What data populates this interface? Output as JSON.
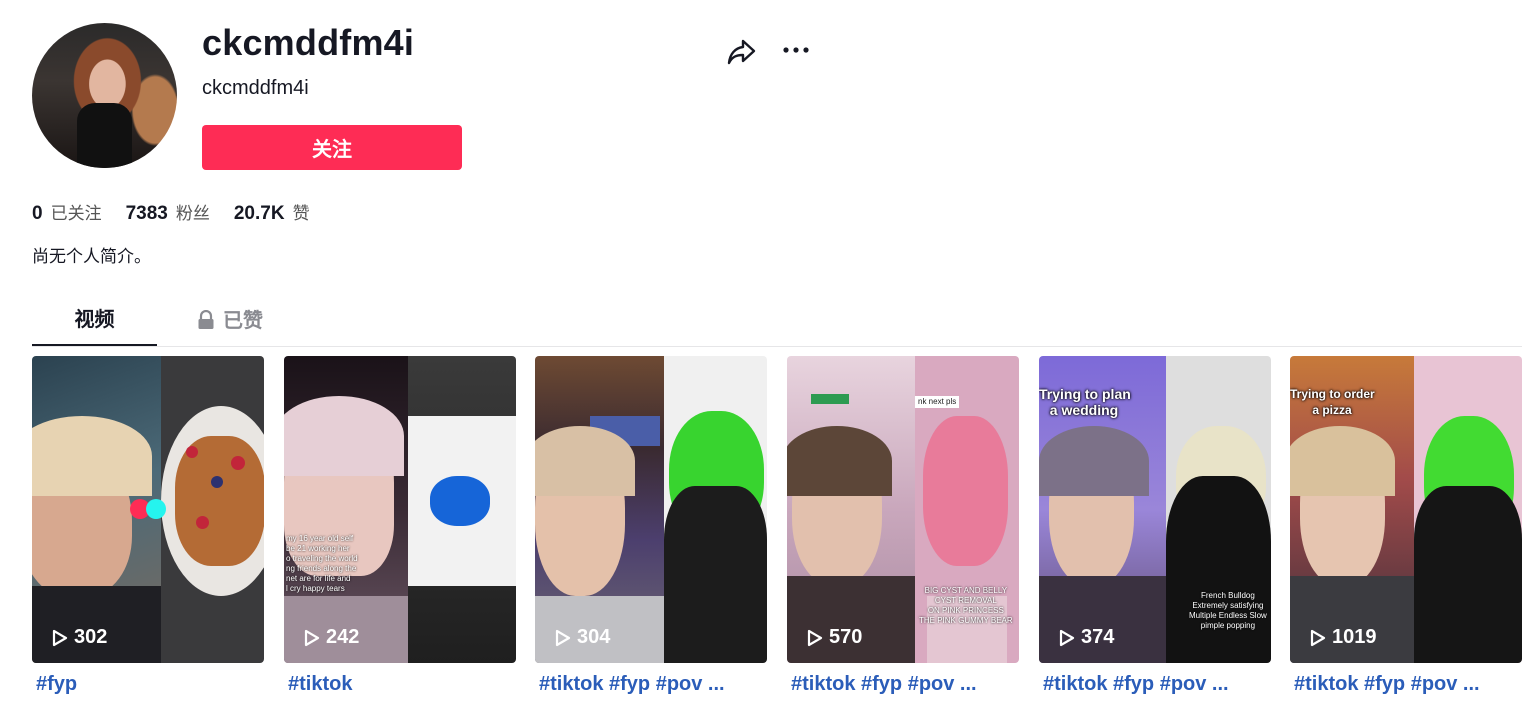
{
  "profile": {
    "username": "ckcmddfm4i",
    "nickname": "ckcmddfm4i",
    "follow_label": "关注",
    "bio": "尚无个人简介。"
  },
  "stats": [
    {
      "value": "0",
      "label": "已关注"
    },
    {
      "value": "7383",
      "label": "粉丝"
    },
    {
      "value": "20.7K",
      "label": "赞"
    }
  ],
  "tabs": {
    "videos": "视频",
    "liked": "已赞"
  },
  "colors": {
    "accent": "#fe2c55",
    "caption": "#2b5db9",
    "text": "#161823"
  },
  "videos": [
    {
      "views": "302",
      "caption": "#fyp"
    },
    {
      "views": "242",
      "caption": "#tiktok"
    },
    {
      "views": "304",
      "caption": "#tiktok #fyp #pov ..."
    },
    {
      "views": "570",
      "caption": "#tiktok #fyp #pov ..."
    },
    {
      "views": "374",
      "caption": "#tiktok #fyp #pov ..."
    },
    {
      "views": "1019",
      "caption": "#tiktok #fyp #pov ..."
    }
  ],
  "overlays": {
    "v2_text": "my 16 year old self\nbe 21 working her\no traveling the world\nng friends along the\nnet are for life and\nl cry happy tears",
    "v4_top": "nk next pls",
    "v4_bottom": "BIG CYST AND BELLY\nCYST REMOVAL\nON PINK PRINCESS\nTHE PINK GUMMY BEAR",
    "v5_top": "Trying to plan\na wedding",
    "v5_bottom": "French Bulldog\nExtremely satisfying\nMultiple Endless Slow\npimple popping",
    "v6_top": "Trying to order\na pizza"
  }
}
